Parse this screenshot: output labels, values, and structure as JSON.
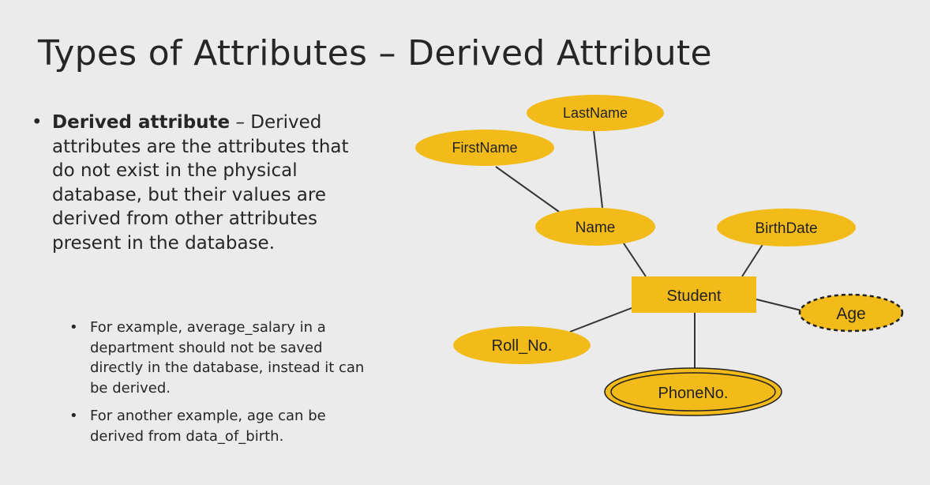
{
  "slide": {
    "title": "Types of Attributes – Derived Attribute",
    "main_bullet": {
      "term": "Derived attribute",
      "text": " – Derived attributes are the attributes that do not exist in the physical database, but their values are derived from other attributes present in the database."
    },
    "sub_bullets": [
      "For example, average_salary in a department should not be saved directly in the database, instead it can be derived.",
      "For another example, age can be derived from data_of_birth."
    ]
  },
  "diagram": {
    "entity": "Student",
    "attributes": {
      "first_name": "FirstName",
      "last_name": "LastName",
      "name": "Name",
      "birth_date": "BirthDate",
      "age": "Age",
      "roll_no": "Roll_No.",
      "phone_no": "PhoneNo."
    },
    "fill_color": "#f2bb1a",
    "line_color": "#333333"
  }
}
